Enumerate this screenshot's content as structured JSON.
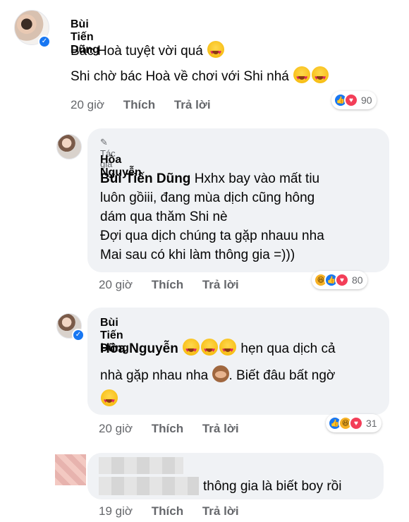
{
  "comments": [
    {
      "name": "Bùi Tiến Dũng",
      "lines": [
        "Bác Hoà tuyệt vời quá",
        "Shi chờ bác Hoà về chơi với Shi nhá"
      ],
      "time": "20 giờ",
      "like": "Thích",
      "reply": "Trả lời",
      "reactions": [
        "like-icon",
        "love-icon"
      ],
      "reaction_count": "90"
    },
    {
      "badge": "Tác giả",
      "name": "Hòa Nguyễn",
      "mention": "Bùi Tiến Dũng",
      "line1": " Hxhx bay vào mất tiu",
      "line2": "luôn gồiii, đang mùa dịch cũng hông",
      "line3": "dám qua thăm Shi nè",
      "line4": "Đợi qua dịch chúng ta gặp nhauu nha",
      "line5": "Mai sau có khi làm thông gia =)))",
      "time": "20 giờ",
      "like": "Thích",
      "reply": "Trả lời",
      "reactions": [
        "haha-icon",
        "like-icon",
        "love-icon"
      ],
      "reaction_count": "80"
    },
    {
      "name": "Bùi Tiến Dũng",
      "mention": "Hòa Nguyễn",
      "line1": " hẹn qua dịch cả",
      "line2": "nhà gặp nhau nha",
      "line2b": ". Biết đâu bất ngờ",
      "time": "20 giờ",
      "like": "Thích",
      "reply": "Trả lời",
      "reactions": [
        "like-icon",
        "haha-icon",
        "love-icon"
      ],
      "reaction_count": "31"
    },
    {
      "line1": "thông gia là biết boy rồi",
      "time": "19 giờ",
      "like": "Thích",
      "reply": "Trả lời"
    }
  ]
}
